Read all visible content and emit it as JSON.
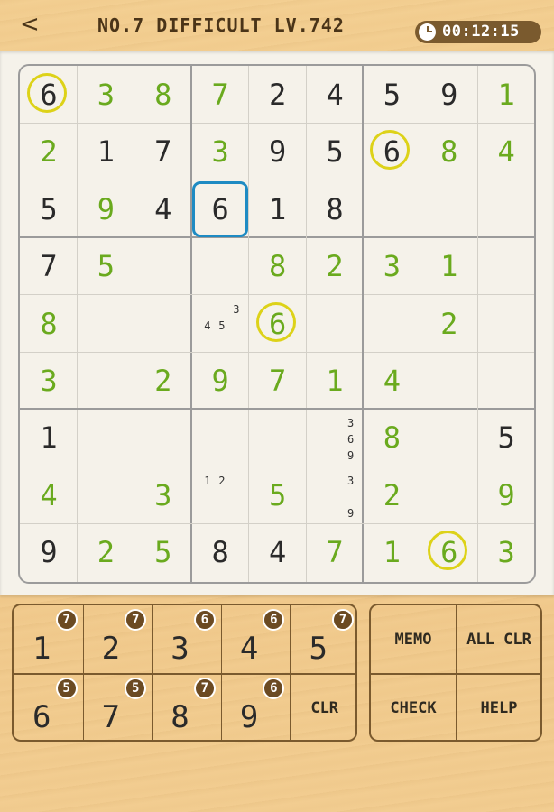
{
  "header": {
    "back_label": "<",
    "title": "NO.7 DIFFICULT LV.742",
    "timer": "00:12:15",
    "timer_icon": "clock-icon"
  },
  "board": {
    "selected": [
      2,
      3
    ],
    "highlight_digit": "6",
    "colors": {
      "given": "#2a2a2a",
      "entered": "#6aaa1e",
      "highlight": "#ddd218",
      "selection": "#1e8bc3"
    },
    "rows": [
      [
        {
          "v": "6",
          "t": "g"
        },
        {
          "v": "3",
          "t": "e"
        },
        {
          "v": "8",
          "t": "e"
        },
        {
          "v": "7",
          "t": "e"
        },
        {
          "v": "2",
          "t": "g"
        },
        {
          "v": "4",
          "t": "g"
        },
        {
          "v": "5",
          "t": "g"
        },
        {
          "v": "9",
          "t": "g"
        },
        {
          "v": "1",
          "t": "e"
        }
      ],
      [
        {
          "v": "2",
          "t": "e"
        },
        {
          "v": "1",
          "t": "g"
        },
        {
          "v": "7",
          "t": "g"
        },
        {
          "v": "3",
          "t": "e"
        },
        {
          "v": "9",
          "t": "g"
        },
        {
          "v": "5",
          "t": "g"
        },
        {
          "v": "6",
          "t": "g"
        },
        {
          "v": "8",
          "t": "e"
        },
        {
          "v": "4",
          "t": "e"
        }
      ],
      [
        {
          "v": "5",
          "t": "g"
        },
        {
          "v": "9",
          "t": "e"
        },
        {
          "v": "4",
          "t": "g"
        },
        {
          "v": "6",
          "t": "g"
        },
        {
          "v": "1",
          "t": "g"
        },
        {
          "v": "8",
          "t": "g"
        },
        {
          "v": "",
          "t": ""
        },
        {
          "v": "",
          "t": ""
        },
        {
          "v": "",
          "t": ""
        }
      ],
      [
        {
          "v": "7",
          "t": "g"
        },
        {
          "v": "5",
          "t": "e"
        },
        {
          "v": "",
          "t": ""
        },
        {
          "v": "",
          "t": ""
        },
        {
          "v": "8",
          "t": "e"
        },
        {
          "v": "2",
          "t": "e"
        },
        {
          "v": "3",
          "t": "e"
        },
        {
          "v": "1",
          "t": "e"
        },
        {
          "v": "",
          "t": ""
        }
      ],
      [
        {
          "v": "8",
          "t": "e"
        },
        {
          "v": "",
          "t": ""
        },
        {
          "v": "",
          "t": ""
        },
        {
          "v": "",
          "t": "",
          "memo": [
            "3",
            "4",
            "5"
          ]
        },
        {
          "v": "6",
          "t": "e"
        },
        {
          "v": "",
          "t": ""
        },
        {
          "v": "",
          "t": ""
        },
        {
          "v": "2",
          "t": "e"
        },
        {
          "v": "",
          "t": ""
        }
      ],
      [
        {
          "v": "3",
          "t": "e"
        },
        {
          "v": "",
          "t": ""
        },
        {
          "v": "2",
          "t": "e"
        },
        {
          "v": "9",
          "t": "e"
        },
        {
          "v": "7",
          "t": "e"
        },
        {
          "v": "1",
          "t": "e"
        },
        {
          "v": "4",
          "t": "e"
        },
        {
          "v": "",
          "t": ""
        },
        {
          "v": "",
          "t": ""
        }
      ],
      [
        {
          "v": "1",
          "t": "g"
        },
        {
          "v": "",
          "t": ""
        },
        {
          "v": "",
          "t": ""
        },
        {
          "v": "",
          "t": ""
        },
        {
          "v": "",
          "t": ""
        },
        {
          "v": "",
          "t": "",
          "memo": [
            "3",
            "6",
            "9"
          ]
        },
        {
          "v": "8",
          "t": "e"
        },
        {
          "v": "",
          "t": ""
        },
        {
          "v": "5",
          "t": "g"
        }
      ],
      [
        {
          "v": "4",
          "t": "e"
        },
        {
          "v": "",
          "t": ""
        },
        {
          "v": "3",
          "t": "e"
        },
        {
          "v": "",
          "t": "",
          "memo": [
            "1",
            "2"
          ]
        },
        {
          "v": "5",
          "t": "e"
        },
        {
          "v": "",
          "t": "",
          "memo": [
            "3",
            "9"
          ]
        },
        {
          "v": "2",
          "t": "e"
        },
        {
          "v": "",
          "t": ""
        },
        {
          "v": "9",
          "t": "e"
        }
      ],
      [
        {
          "v": "9",
          "t": "g"
        },
        {
          "v": "2",
          "t": "e"
        },
        {
          "v": "5",
          "t": "e"
        },
        {
          "v": "8",
          "t": "g"
        },
        {
          "v": "4",
          "t": "g"
        },
        {
          "v": "7",
          "t": "e"
        },
        {
          "v": "1",
          "t": "e"
        },
        {
          "v": "6",
          "t": "e"
        },
        {
          "v": "3",
          "t": "e"
        }
      ]
    ]
  },
  "keypad": {
    "numbers": [
      {
        "digit": "1",
        "remaining": "7"
      },
      {
        "digit": "2",
        "remaining": "7"
      },
      {
        "digit": "3",
        "remaining": "6"
      },
      {
        "digit": "4",
        "remaining": "6"
      },
      {
        "digit": "5",
        "remaining": "7"
      },
      {
        "digit": "6",
        "remaining": "5"
      },
      {
        "digit": "7",
        "remaining": "5"
      },
      {
        "digit": "8",
        "remaining": "7"
      },
      {
        "digit": "9",
        "remaining": "6"
      }
    ],
    "clear_label": "CLR"
  },
  "actions": {
    "memo": "MEMO",
    "all_clear": "ALL CLR",
    "check": "CHECK",
    "help": "HELP"
  }
}
